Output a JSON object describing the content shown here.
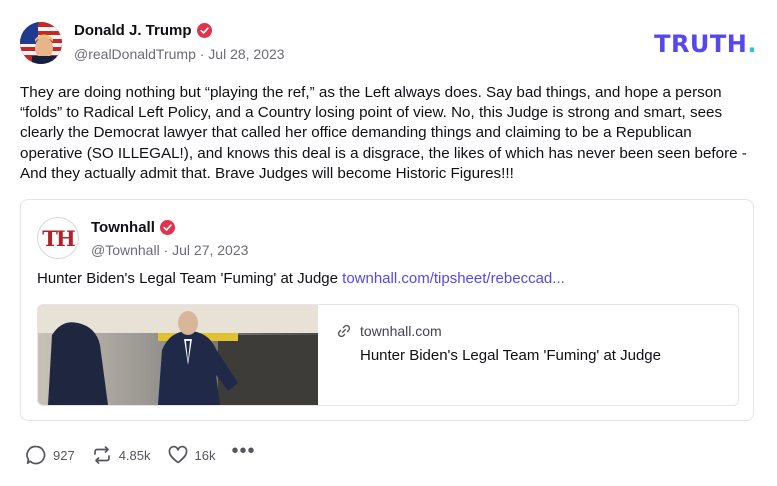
{
  "author": {
    "name": "Donald J. Trump",
    "handle_date": "@realDonaldTrump · Jul 28, 2023"
  },
  "brand": {
    "text": "TRUTH",
    "dot": ".",
    "color": "#5448ee",
    "dot_color": "#25c9d0"
  },
  "post": {
    "text": "They are doing nothing but “playing the ref,” as the Left always does. Say bad things, and hope a person “folds” to Radical Left Policy, and a Country losing point of view. No, this Judge is strong and smart, sees clearly the Democrat lawyer that called her office demanding things and claiming to be a Republican operative (SO ILLEGAL!), and knows this deal is a disgrace, the likes of which has never been seen before - And they actually admit that. Brave Judges will become Historic Figures!!!"
  },
  "quoted": {
    "avatar_text": "TH",
    "name": "Townhall",
    "handle_date": "@Townhall · Jul 27, 2023",
    "text": "Hunter Biden's Legal Team 'Fuming' at Judge ",
    "link": "townhall.com/tipsheet/rebeccad...",
    "card": {
      "domain": "townhall.com",
      "title": "Hunter Biden's Legal Team 'Fuming' at Judge"
    }
  },
  "actions": {
    "replies": "927",
    "retruths": "4.85k",
    "likes": "16k"
  },
  "icons": {
    "verified": "verified-badge-icon",
    "reply": "comment-icon",
    "retruth": "repost-icon",
    "like": "heart-icon",
    "more": "more-dots-icon",
    "link": "link-icon"
  },
  "colors": {
    "verified": "#e0334e",
    "link": "#5448ee"
  }
}
